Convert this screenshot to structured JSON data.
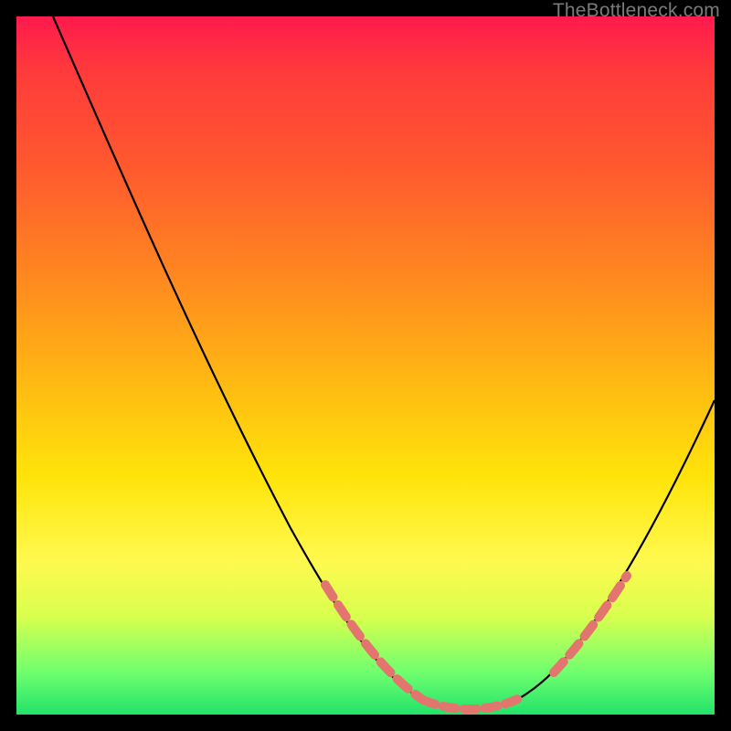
{
  "watermark": "TheBottleneck.com",
  "chart_data": {
    "type": "line",
    "title": "",
    "xlabel": "",
    "ylabel": "",
    "xlim": [
      0,
      100
    ],
    "ylim": [
      0,
      100
    ],
    "grid": false,
    "series": [
      {
        "name": "bottleneck-curve",
        "x": [
          5,
          10,
          15,
          20,
          25,
          30,
          35,
          40,
          45,
          50,
          53,
          56,
          59,
          62,
          65,
          68,
          72,
          76,
          80,
          84,
          88,
          92,
          96,
          100
        ],
        "values": [
          100,
          90,
          80,
          70,
          60,
          50,
          41,
          32,
          24,
          16,
          12,
          8,
          5,
          3,
          2,
          2,
          3,
          6,
          10,
          16,
          24,
          33,
          43,
          54
        ]
      }
    ],
    "highlight_segments": [
      {
        "name": "left-arm-dots",
        "x_range": [
          51,
          62
        ],
        "approx_y_range": [
          2,
          14
        ]
      },
      {
        "name": "valley-dots",
        "x_range": [
          62,
          74
        ],
        "approx_y_range": [
          1,
          3
        ]
      },
      {
        "name": "right-arm-dots",
        "x_range": [
          78,
          86
        ],
        "approx_y_range": [
          8,
          20
        ]
      }
    ],
    "background_gradient": {
      "top": "#ff1a4d",
      "mid": "#ffe40a",
      "bottom": "#22e26a"
    }
  }
}
